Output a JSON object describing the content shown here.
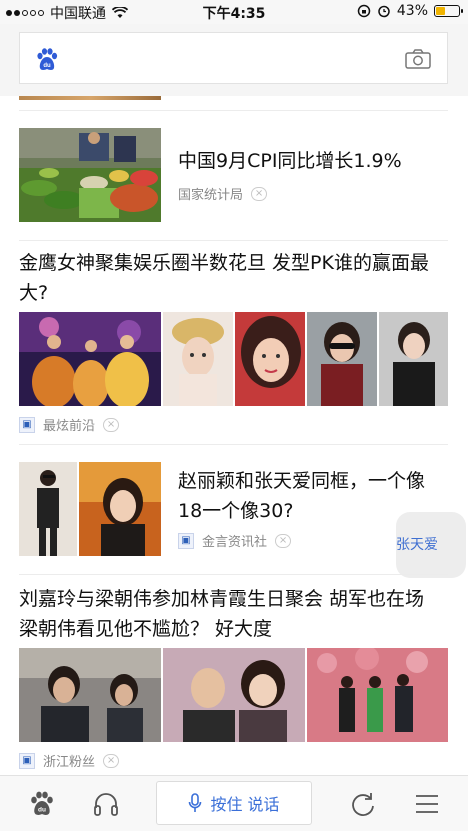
{
  "status_bar": {
    "carrier": "中国联通",
    "time": "下午4:35",
    "battery_percent": "43%",
    "battery_level": 0.43
  },
  "search": {
    "placeholder": ""
  },
  "feed": [
    {
      "title": "中国9月CPI同比增长1.9%",
      "source": "国家统计局",
      "close": "×"
    },
    {
      "title": "金鹰女神聚集娱乐圈半数花旦 发型PK谁的赢面最大?",
      "source": "最炫前沿",
      "close": "×"
    },
    {
      "title": "赵丽颖和张天爱同框，一个像18一个像30?",
      "source": "金言资讯社",
      "close": "×",
      "tag": "张天爱"
    },
    {
      "title": "刘嘉玲与梁朝伟参加林青霞生日聚会 胡军也在场 梁朝伟看见他不尴尬？ 好大度",
      "source": "浙江粉丝",
      "close": "×"
    }
  ],
  "bottom_bar": {
    "voice_label": "按住 说话"
  },
  "colors": {
    "accent": "#3a6fd8",
    "battery": "#f0b400"
  }
}
